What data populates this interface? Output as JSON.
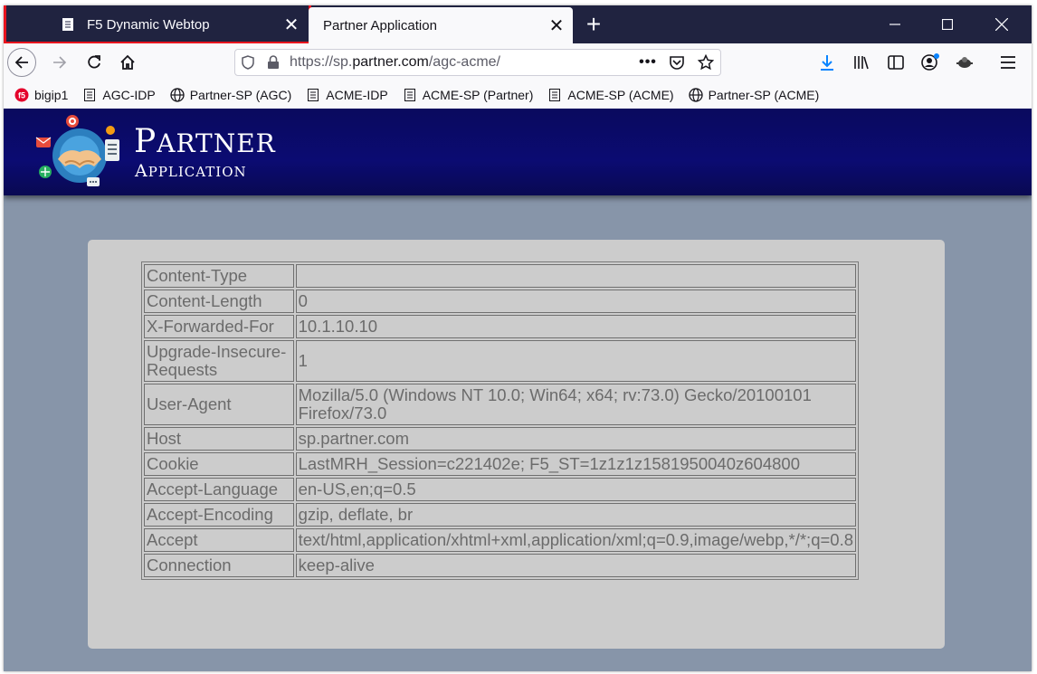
{
  "browser": {
    "tabs": [
      {
        "label": "F5 Dynamic Webtop",
        "active": false
      },
      {
        "label": "Partner Application",
        "active": true
      }
    ],
    "url": {
      "scheme": "https://sp.",
      "domain": "partner.com",
      "path": "/agc-acme/"
    },
    "bookmarks": [
      {
        "label": "bigip1",
        "icon": "f5-icon"
      },
      {
        "label": "AGC-IDP",
        "icon": "page-icon"
      },
      {
        "label": "Partner-SP (AGC)",
        "icon": "globe-icon"
      },
      {
        "label": "ACME-IDP",
        "icon": "page-icon"
      },
      {
        "label": "ACME-SP (Partner)",
        "icon": "page-icon"
      },
      {
        "label": "ACME-SP (ACME)",
        "icon": "page-icon"
      },
      {
        "label": "Partner-SP (ACME)",
        "icon": "globe-icon"
      }
    ]
  },
  "site": {
    "title": "Partner",
    "subtitle": "Application"
  },
  "headers": [
    {
      "name": "Content-Type",
      "value": ""
    },
    {
      "name": "Content-Length",
      "value": "0"
    },
    {
      "name": "X-Forwarded-For",
      "value": "10.1.10.10"
    },
    {
      "name": "Upgrade-Insecure-Requests",
      "value": "1"
    },
    {
      "name": "User-Agent",
      "value": "Mozilla/5.0 (Windows NT 10.0; Win64; x64; rv:73.0) Gecko/20100101 Firefox/73.0"
    },
    {
      "name": "Host",
      "value": "sp.partner.com"
    },
    {
      "name": "Cookie",
      "value": "LastMRH_Session=c221402e; F5_ST=1z1z1z1581950040z604800"
    },
    {
      "name": "Accept-Language",
      "value": "en-US,en;q=0.5"
    },
    {
      "name": "Accept-Encoding",
      "value": "gzip, deflate, br"
    },
    {
      "name": "Accept",
      "value": "text/html,application/xhtml+xml,application/xml;q=0.9,image/webp,*/*;q=0.8"
    },
    {
      "name": "Connection",
      "value": "keep-alive"
    }
  ],
  "colors": {
    "tabstrip": "#202340",
    "banner": "#0b0b72",
    "page_bg": "#8795a9",
    "card": "#cccccc",
    "highlight": "#e8141e"
  }
}
